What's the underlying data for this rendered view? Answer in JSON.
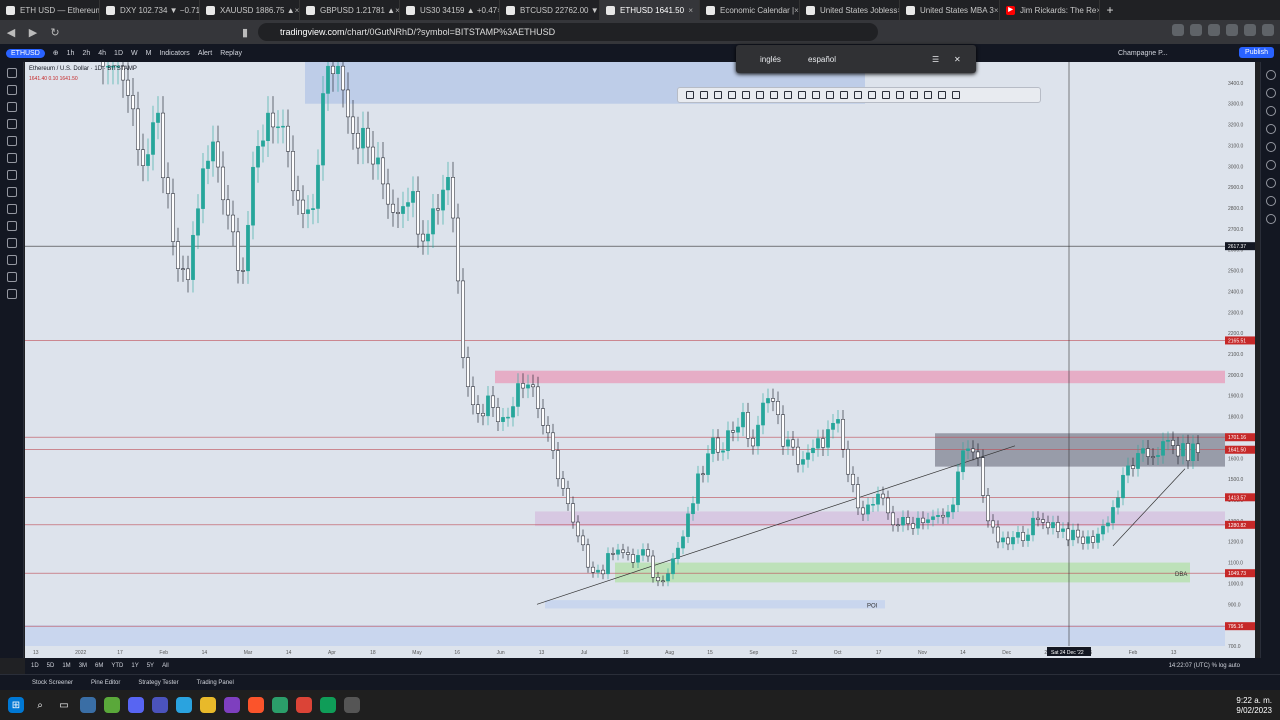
{
  "browser": {
    "tabs": [
      {
        "label": "ETH USD — Ethereum",
        "icon": "tradingview-icon"
      },
      {
        "label": "DXY 102.734 ▼ −0.71",
        "icon": "tradingview-icon"
      },
      {
        "label": "XAUUSD 1886.75 ▲",
        "icon": "tradingview-icon"
      },
      {
        "label": "GBPUSD 1.21781 ▲",
        "icon": "tradingview-icon"
      },
      {
        "label": "US30 34159 ▲ +0.47",
        "icon": "tradingview-icon"
      },
      {
        "label": "BTCUSD 22762.00 ▼",
        "icon": "tradingview-icon"
      },
      {
        "label": "ETHUSD 1641.50",
        "icon": "tradingview-icon"
      },
      {
        "label": "Economic Calendar |",
        "icon": "calendar-icon"
      },
      {
        "label": "United States Jobless",
        "icon": "calendar-icon"
      },
      {
        "label": "United States MBA 3",
        "icon": "calendar-icon"
      },
      {
        "label": "Jim Rickards: The Re",
        "icon": "youtube-icon"
      }
    ],
    "url_host": "tradingview.com",
    "url_path": "/chart/0GutNRhD/?symbol=BITSTAMP%3AETHUSD"
  },
  "translate_popup": {
    "lang1": "inglés",
    "lang2": "español"
  },
  "tv_toolbar": {
    "symbol": "ETHUSD",
    "intervals": [
      "1h",
      "2h",
      "4h",
      "1D",
      "W",
      "M"
    ],
    "indicators": "Indicators",
    "alert": "Alert",
    "replay": "Replay",
    "layout_name": "Champagne P...",
    "publish": "Publish"
  },
  "chart_header": {
    "title": "Ethereum / U.S. Dollar · 1D · BITSTAMP",
    "ohlc": "1641.40  0.10  1641.50"
  },
  "chart_data": {
    "type": "candlestick",
    "ylim": [
      700,
      3500
    ],
    "y_ticks": [
      3400,
      3300,
      3200,
      3100,
      3000,
      2900,
      2800,
      2700,
      2600,
      2500,
      2400,
      2300,
      2200,
      2100,
      2000,
      1900,
      1800,
      1700,
      1600,
      1500,
      1400,
      1300,
      1200,
      1100,
      1000,
      900,
      800,
      700
    ],
    "x_ticks": [
      "13",
      "2022",
      "17",
      "Feb",
      "14",
      "Mar",
      "14",
      "Apr",
      "18",
      "May",
      "16",
      "Jun",
      "13",
      "Jul",
      "18",
      "Aug",
      "15",
      "Sep",
      "12",
      "Oct",
      "17",
      "Nov",
      "14",
      "Dec",
      "23",
      "16",
      "Feb",
      "13"
    ],
    "close_path": [
      3800,
      3550,
      3300,
      3000,
      3200,
      2600,
      2400,
      2900,
      3100,
      2800,
      2500,
      3000,
      3300,
      3100,
      2800,
      2700,
      3400,
      3550,
      3200,
      3100,
      2950,
      2800,
      2900,
      2700,
      2800,
      3000,
      2100,
      1800,
      1900,
      1750,
      2000,
      1950,
      1700,
      1500,
      1250,
      1100,
      1050,
      1200,
      1100,
      1150,
      1000,
      1100,
      1250,
      1500,
      1650,
      1700,
      1800,
      1650,
      1950,
      1700,
      1600,
      1600,
      1700,
      1750,
      1450,
      1350,
      1400,
      1300,
      1280,
      1320,
      1300,
      1330,
      1600,
      1640,
      1250,
      1180,
      1220,
      1280,
      1300,
      1270,
      1220,
      1200,
      1250,
      1380,
      1560,
      1600,
      1640,
      1660,
      1620,
      1641
    ],
    "price_labels": [
      {
        "text": "2617.37",
        "value": 2617
      },
      {
        "text": "2165.51",
        "value": 2165
      },
      {
        "text": "1701.16",
        "value": 1701
      },
      {
        "text": "1641.50",
        "value": 1641
      },
      {
        "text": "1413.57",
        "value": 1413
      },
      {
        "text": "1280.82",
        "value": 1281
      },
      {
        "text": "1049.73",
        "value": 1049
      },
      {
        "text": "795.16",
        "value": 795
      }
    ],
    "zones": [
      {
        "name": "top-supply",
        "from": 3300,
        "to": 3520,
        "color": "#b9c9e8"
      },
      {
        "name": "pink-supply",
        "from": 1960,
        "to": 2020,
        "color": "#e8a3c0"
      },
      {
        "name": "gray-range",
        "from": 1560,
        "to": 1720,
        "color": "#8c8f9e"
      },
      {
        "name": "purple-zone",
        "from": 1275,
        "to": 1345,
        "color": "#d6c3e0"
      },
      {
        "name": "green-demand",
        "from": 1005,
        "to": 1100,
        "color": "#b7e0b0"
      },
      {
        "name": "poi",
        "from": 880,
        "to": 920,
        "color": "#c5d3ef"
      },
      {
        "name": "bottom",
        "from": 700,
        "to": 800,
        "color": "#c5d3ef"
      }
    ],
    "annotations": [
      "POI",
      "DBA"
    ],
    "crosshair_date": "Sat 24 Dec '22"
  },
  "bottom_bar": {
    "ranges": [
      "1D",
      "5D",
      "1M",
      "3M",
      "6M",
      "YTD",
      "1Y",
      "5Y",
      "All"
    ],
    "time": "14:22:07 (UTC)",
    "scale": "%",
    "log": "log",
    "auto": "auto"
  },
  "panels": [
    "Stock Screener",
    "Pine Editor",
    "Strategy Tester",
    "Trading Panel"
  ],
  "taskbar": {
    "time": "9:22 a. m.",
    "date": "9/02/2023"
  }
}
